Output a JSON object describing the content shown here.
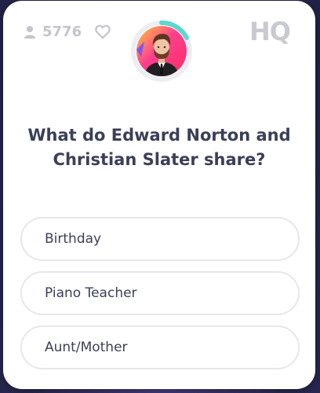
{
  "header": {
    "viewer_count": "5776",
    "logo_text": "HQ"
  },
  "question": {
    "text": "What do Edward Norton and Christian Slater share?"
  },
  "answers": [
    {
      "label": "Birthday"
    },
    {
      "label": "Piano Teacher"
    },
    {
      "label": "Aunt/Mother"
    }
  ],
  "colors": {
    "background": "#2b2a55",
    "card": "#ffffff",
    "text": "#3b3f58",
    "muted": "#c4c4cc",
    "answer_border": "#e7e7ec",
    "timer_ring": "#5fd6d0"
  },
  "icons": {
    "viewers": "person-icon",
    "like": "heart-icon",
    "host": "host-avatar"
  }
}
